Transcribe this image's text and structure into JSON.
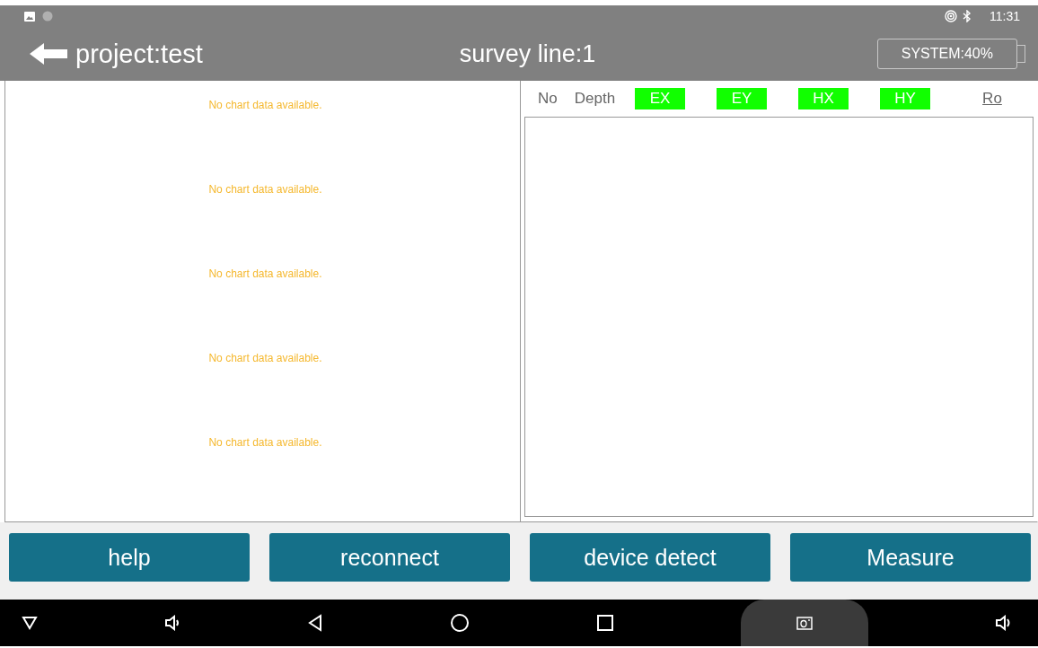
{
  "status_bar": {
    "time": "11:31"
  },
  "header": {
    "project": "project:test",
    "survey_line": "survey line:1",
    "battery": "SYSTEM:40%"
  },
  "charts": [
    {
      "message": "No chart data available."
    },
    {
      "message": "No chart data available."
    },
    {
      "message": "No chart data available."
    },
    {
      "message": "No chart data available."
    },
    {
      "message": "No chart data available."
    }
  ],
  "table": {
    "columns": [
      {
        "label": "No",
        "highlighted": false,
        "underlined": false
      },
      {
        "label": "Depth",
        "highlighted": false,
        "underlined": false
      },
      {
        "label": "EX",
        "highlighted": true,
        "underlined": false
      },
      {
        "label": "EY",
        "highlighted": true,
        "underlined": false
      },
      {
        "label": "HX",
        "highlighted": true,
        "underlined": false
      },
      {
        "label": "HY",
        "highlighted": true,
        "underlined": false
      },
      {
        "label": "Ro",
        "highlighted": false,
        "underlined": true
      }
    ]
  },
  "buttons": [
    "help",
    "reconnect",
    "device detect",
    "Measure"
  ]
}
